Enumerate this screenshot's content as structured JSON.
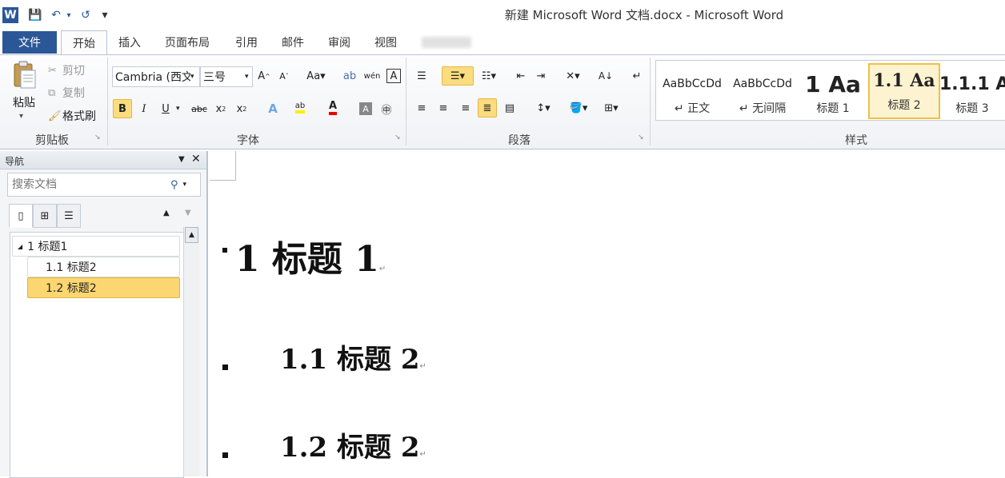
{
  "window": {
    "title": "新建 Microsoft Word 文档.docx - Microsoft Word",
    "app_icon": "W"
  },
  "quick_access": {
    "save": "💾",
    "undo": "↶",
    "redo": "↺",
    "customize": "▾"
  },
  "tabs": [
    "文件",
    "开始",
    "插入",
    "页面布局",
    "引用",
    "邮件",
    "审阅",
    "视图"
  ],
  "ribbon": {
    "clipboard": {
      "label": "剪贴板",
      "paste": "粘贴",
      "cut": "剪切",
      "copy": "复制",
      "format_painter": "格式刷"
    },
    "font": {
      "label": "字体",
      "font_name": "Cambria (西文",
      "font_size": "三号"
    },
    "paragraph": {
      "label": "段落"
    },
    "styles": {
      "label": "样式",
      "items": [
        {
          "sample": "AaBbCcDd",
          "name": "↵ 正文"
        },
        {
          "sample": "AaBbCcDd",
          "name": "↵ 无间隔"
        },
        {
          "sample": "1 Aa",
          "name": "标题 1"
        },
        {
          "sample": "1.1 Aa",
          "name": "标题 2"
        },
        {
          "sample": "1.1.1 A",
          "name": "标题 3"
        }
      ]
    }
  },
  "nav": {
    "title": "导航",
    "search_placeholder": "搜索文档",
    "tree": [
      {
        "label": "1 标题1"
      },
      {
        "label": "1.1 标题2"
      },
      {
        "label": "1.2 标题2"
      }
    ]
  },
  "document": {
    "headings": [
      {
        "text": "1  标题 1",
        "level": 1
      },
      {
        "text": "1.1  标题 2",
        "level": 2
      },
      {
        "text": "1.2  标题 2",
        "level": 2
      }
    ],
    "para_mark": "↵"
  },
  "colors": {
    "file_tab": "#2b5797",
    "highlight": "#fbdc7e",
    "selected_nav": "#fbd671"
  }
}
